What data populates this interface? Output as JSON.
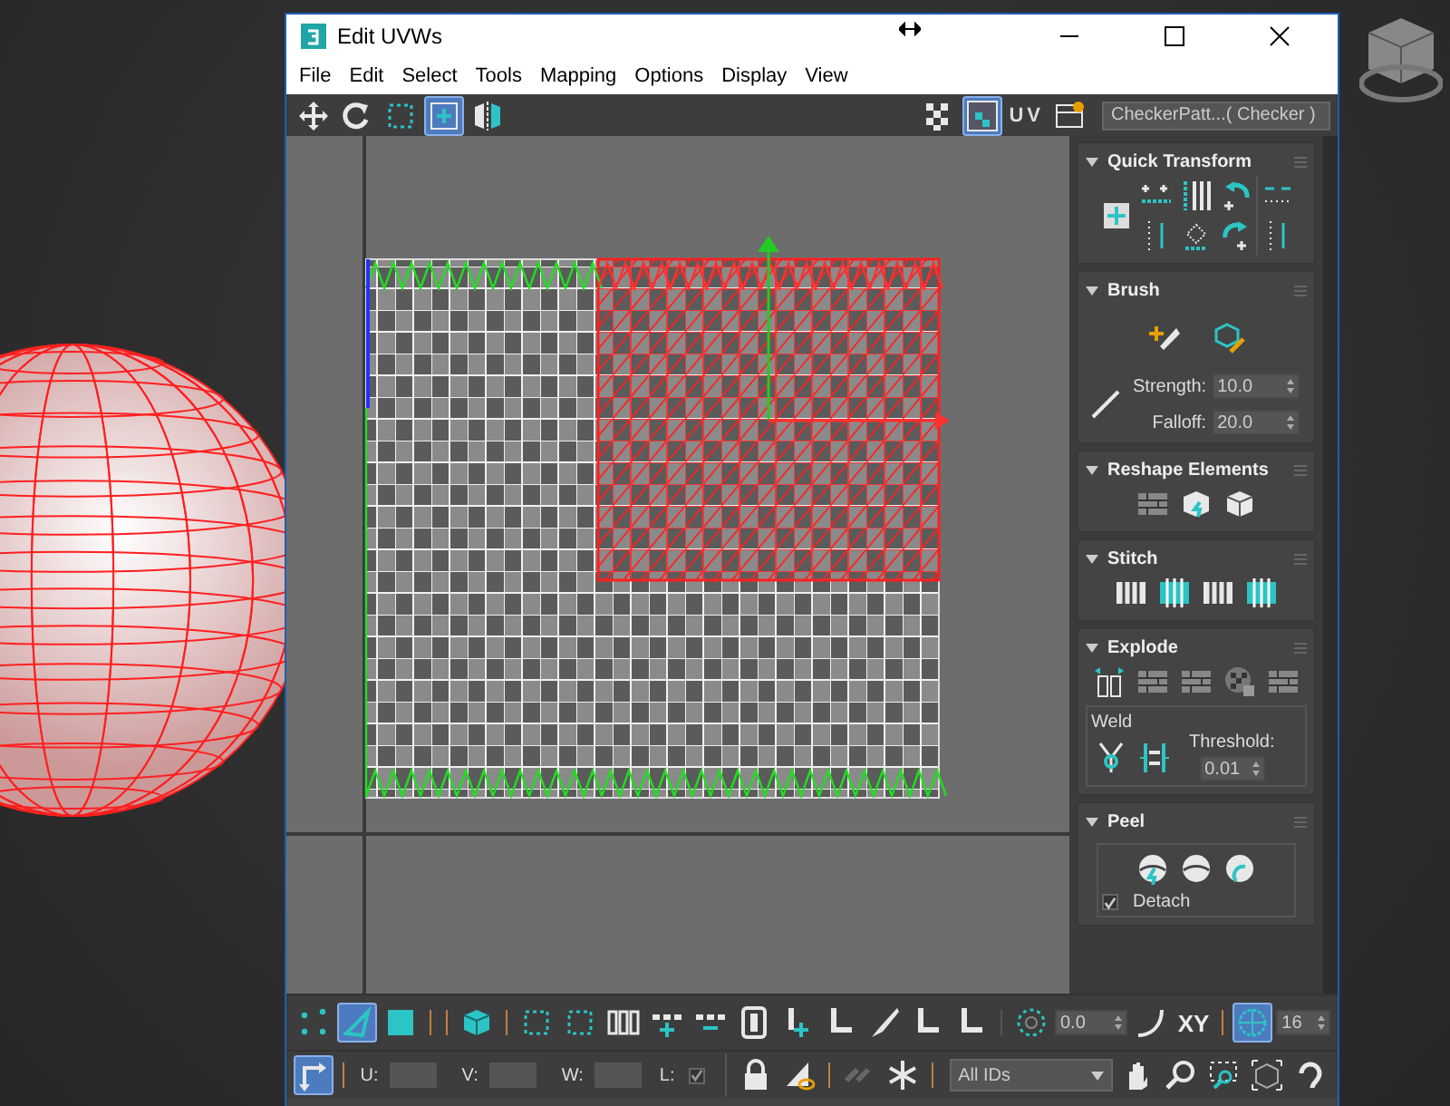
{
  "window": {
    "title": "Edit UVWs"
  },
  "menu": [
    "File",
    "Edit",
    "Select",
    "Tools",
    "Mapping",
    "Options",
    "Display",
    "View"
  ],
  "toolbar": {
    "left_tools": [
      {
        "selected": false
      },
      {
        "selected": false
      },
      {
        "selected": false
      },
      {
        "selected": true
      },
      {
        "selected": false
      }
    ],
    "grid_view_selected": true,
    "uv_label": "UV",
    "texture_dropdown": "CheckerPatt...( Checker )"
  },
  "panel": {
    "quick_transform": {
      "title": "Quick Transform"
    },
    "brush": {
      "title": "Brush",
      "strength_label": "Strength:",
      "strength": "10.0",
      "falloff_label": "Falloff:",
      "falloff": "20.0"
    },
    "reshape": {
      "title": "Reshape Elements"
    },
    "stitch": {
      "title": "Stitch"
    },
    "explode": {
      "title": "Explode",
      "weld_label": "Weld",
      "threshold_label": "Threshold:",
      "threshold": "0.01"
    },
    "peel": {
      "title": "Peel",
      "detach_label": "Detach",
      "detach_checked": true
    }
  },
  "bottom_toolbar": {
    "select_modes": [
      {
        "selected": false
      },
      {
        "selected": true
      },
      {
        "selected": false
      },
      {
        "selected": false
      }
    ],
    "angle": "0.0",
    "axis": "XY",
    "grid_snap_selected": true,
    "grid_count": "16",
    "transform_mode_selected": true,
    "u_label": "U:",
    "v_label": "V:",
    "w_label": "W:",
    "l_label": "L:",
    "l_checked": true,
    "id_filter": "All IDs"
  }
}
